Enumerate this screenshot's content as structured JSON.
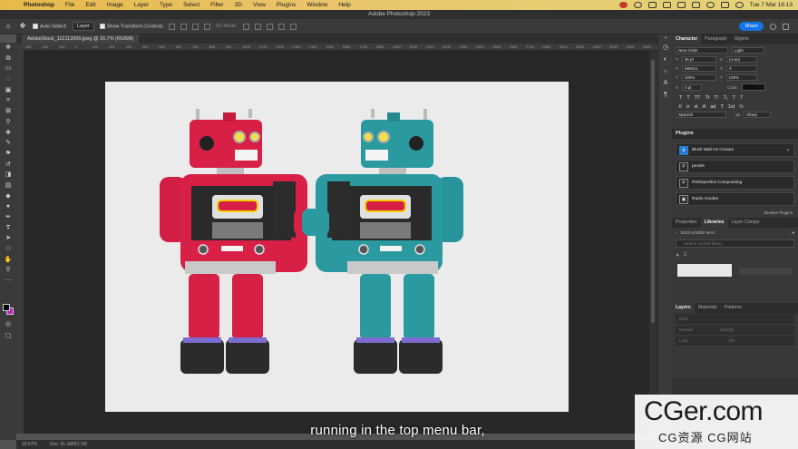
{
  "menubar": {
    "app": "Photoshop",
    "items": [
      "File",
      "Edit",
      "Image",
      "Layer",
      "Type",
      "Select",
      "Filter",
      "3D",
      "View",
      "Plugins",
      "Window",
      "Help"
    ],
    "clock": "Tue 7 Mar  16:13"
  },
  "window": {
    "title": "Adobe Photoshop 2023"
  },
  "options": {
    "auto_select": "Auto-Select:",
    "auto_select_target": "Layer",
    "show_transform": "Show Transform Controls",
    "mode_3d": "3D Mode:",
    "share": "Share"
  },
  "document": {
    "tab": "AdobeStock_112112069.jpeg @ 16.7% (RGB/8)",
    "zoom": "16.67%",
    "doc_size": "Doc: 91.1M/91.1M"
  },
  "ruler_ticks": [
    "300",
    "200",
    "100",
    "0",
    "100",
    "200",
    "300",
    "400",
    "500",
    "600",
    "700",
    "800",
    "900",
    "1000",
    "1100",
    "1200",
    "1300",
    "1400",
    "1500",
    "1600",
    "1700",
    "1800",
    "1900",
    "2000",
    "2100",
    "2200",
    "2300",
    "2400",
    "2500",
    "2600",
    "2700",
    "2800",
    "2900",
    "3000",
    "3100",
    "3200",
    "3300",
    "3400"
  ],
  "caption": "running in the top menu bar,",
  "character": {
    "tabs": [
      "Character",
      "Paragraph",
      "Glyphs"
    ],
    "font": "New Order",
    "style": "Light",
    "size": "36 pt",
    "leading": "(Auto)",
    "kerning": "Metrics",
    "tracking": "0",
    "vscale": "100%",
    "hscale": "100%",
    "baseline": "0 pt",
    "color_label": "Color:",
    "language": "Spanish",
    "antialias": "Sharp"
  },
  "plugins": {
    "title": "Plugins",
    "items": [
      {
        "icon": "blurb",
        "label": "Blurb Wall Art Creator"
      },
      {
        "icon": "P",
        "label": "pexels"
      },
      {
        "icon": "P",
        "label": "P00mperfect Compositing"
      },
      {
        "icon": "▣",
        "label": "Radio Guides"
      }
    ],
    "browse": "Browse Plugins"
  },
  "libraries": {
    "tabs": [
      "Properties",
      "Libraries",
      "Layer Comps"
    ],
    "library_name": "2023 ADOBE MAX",
    "search_placeholder": "Search current library"
  },
  "layers": {
    "tabs": [
      "Layers",
      "Materials",
      "Patterns"
    ],
    "kind": "Kind",
    "blend": "Normal",
    "opacity": "Opacity:",
    "lock": "Lock:",
    "fill": "Fill:"
  },
  "watermark": {
    "big": "CGer.com",
    "small": "CG资源 CG网站"
  },
  "colors": {
    "robot_red": "#d81f46",
    "robot_teal": "#2b9aa0",
    "accent": "#1473e6",
    "foreground": "#000000",
    "background_swatch": "#c31ec3"
  }
}
